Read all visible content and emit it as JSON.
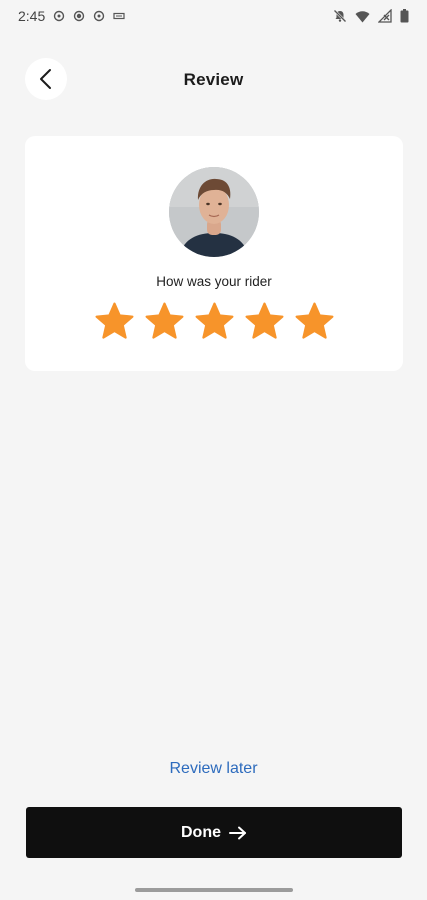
{
  "status_bar": {
    "time": "2:45",
    "left_icons": [
      "notification-icon",
      "notification-icon",
      "location-icon",
      "notification-icon",
      "keyboard-icon"
    ],
    "right_icons": [
      "mute-icon",
      "wifi-icon",
      "no-signal-icon",
      "battery-icon"
    ]
  },
  "header": {
    "title": "Review",
    "back_icon": "chevron-left-icon"
  },
  "card": {
    "prompt": "How was your rider",
    "rating": 5,
    "max_rating": 5,
    "star_color": "#f7942a"
  },
  "footer": {
    "review_later": "Review later",
    "done_label": "Done",
    "done_icon": "arrow-right-icon"
  },
  "colors": {
    "background": "#f5f5f5",
    "card": "#ffffff",
    "link": "#2d6bbd",
    "button": "#0f0f0f"
  }
}
